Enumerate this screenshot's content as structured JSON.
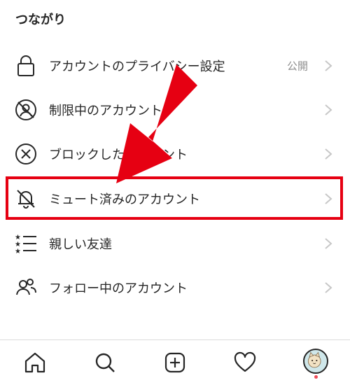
{
  "section": {
    "title": "つながり"
  },
  "items": [
    {
      "label": "アカウントのプライバシー設定",
      "value": "公開",
      "icon": "lock-icon"
    },
    {
      "label": "制限中のアカウント",
      "icon": "restricted-icon"
    },
    {
      "label": "ブロックしたアカウント",
      "icon": "block-icon"
    },
    {
      "label": "ミュート済みのアカウント",
      "icon": "muted-bell-icon"
    },
    {
      "label": "親しい友達",
      "icon": "close-friends-list-icon"
    },
    {
      "label": "フォロー中のアカウント",
      "icon": "following-people-icon"
    }
  ],
  "annotation": {
    "arrow_color": "#e60012",
    "highlight_color": "#e60012"
  },
  "bottom_nav": {
    "icons": [
      "home-icon",
      "search-icon",
      "new-post-icon",
      "activity-heart-icon",
      "profile-avatar"
    ]
  },
  "colors": {
    "text": "#262626",
    "muted": "#8e8e8e",
    "divider": "#dbdbdb",
    "notification_dot": "#ed4956"
  }
}
